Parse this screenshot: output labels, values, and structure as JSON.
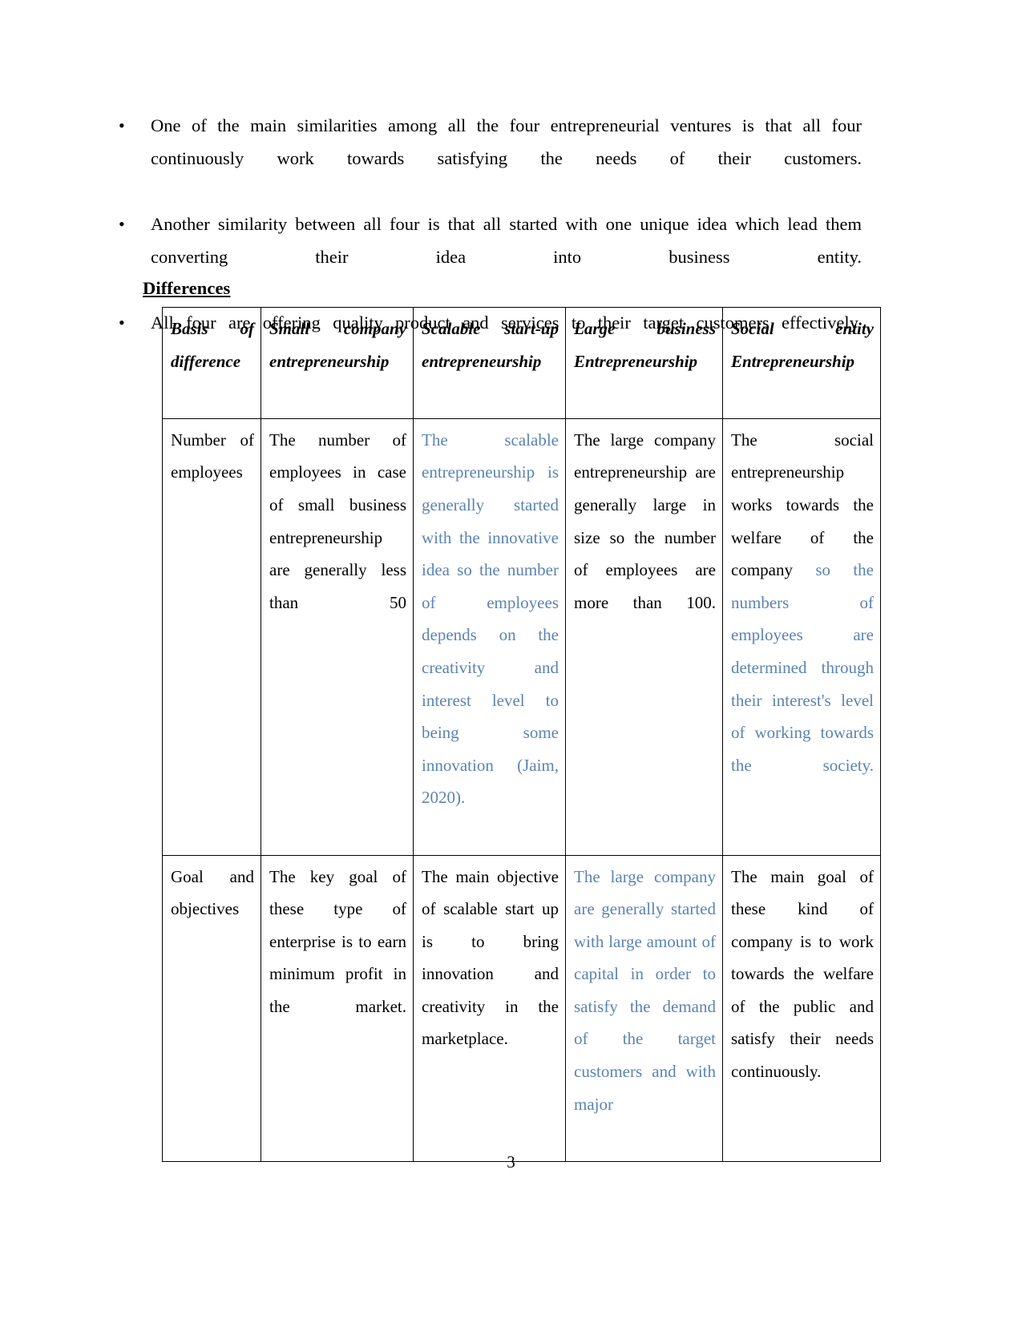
{
  "document": {
    "page_number": "3",
    "bullet_marker": "•",
    "bullets": [
      "One of the main similarities among all the four entrepreneurial ventures is that all four continuously work towards satisfying the needs of their customers.",
      "Another similarity between all four is that all started with one unique idea which lead them converting their idea into business entity.",
      "All four are offering quality product and services to their target customers effectively."
    ],
    "section_heading": "Differences",
    "table": {
      "headers": [
        "Basis of difference",
        "Small company entrepreneurship",
        "Scalable start-up entrepreneurship",
        "Large business Entrepreneurship",
        "Social entity Entrepreneurship"
      ],
      "rows": [
        {
          "basis": "Number of employees",
          "small_company": "The number of employees in case of small business entrepreneurship are generally less than 50",
          "scalable_startup_blue": "The scalable entrepreneurship is generally started with the innovative idea so the number of employees depends on the creativity and interest level to being some innovation (Jaim, 2020).",
          "large_business": "The large company entrepreneurship are generally large in size so the number of employees are more than 100.",
          "social_entity_black": "The social entrepreneurship works towards the welfare of the company ",
          "social_entity_blue": "so the numbers of employees are determined through their interest's level of working towards the society."
        },
        {
          "basis": "Goal and objectives",
          "small_company": "The key goal of these type of enterprise is to earn minimum profit in the market.",
          "scalable_startup": "The main objective of scalable start up is to bring innovation and creativity in the marketplace.",
          "large_business_blue": "The large company are generally started with large amount of capital in order to satisfy the demand of the target customers and with major",
          "social_entity": "The main goal of these kind of company is to work towards the welfare of the public and satisfy their needs continuously."
        }
      ]
    }
  },
  "colors": {
    "blue_text": "#5b84b1",
    "black_text": "#000000",
    "border": "#000000",
    "background": "#ffffff"
  }
}
